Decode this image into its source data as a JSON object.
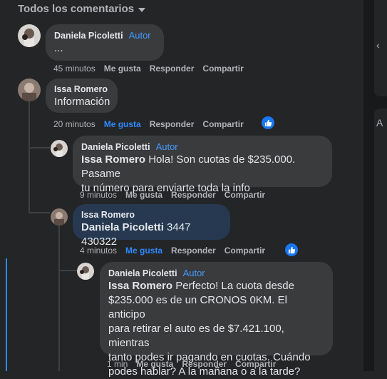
{
  "header": {
    "label": "Todos los comentarios"
  },
  "comments": [
    {
      "author": "Daniela Picoletti",
      "author_badge": "Autor",
      "text": "...",
      "time": "45 minutos",
      "like": "Me gusta",
      "reply": "Responder",
      "share": "Compartir"
    },
    {
      "author": "Issa Romero",
      "text": "Información",
      "time": "20 minutos",
      "like": "Me gusta",
      "reply": "Responder",
      "share": "Compartir",
      "liked": true
    },
    {
      "author": "Daniela Picoletti",
      "author_badge": "Autor",
      "mention": "Issa Romero",
      "text_line1": " Hola! Son cuotas de $235.000. Pasame",
      "text_line2": "tu número para enviarte toda la info",
      "time": "9 minutos",
      "like": "Me gusta",
      "reply": "Responder",
      "share": "Compartir"
    },
    {
      "author": "Issa Romero",
      "mention": "Daniela Picoletti",
      "text": " 3447 430322",
      "time": "4 minutos",
      "like": "Me gusta",
      "reply": "Responder",
      "share": "Compartir",
      "liked": true
    },
    {
      "author": "Daniela Picoletti",
      "author_badge": "Autor",
      "mention": "Issa Romero",
      "text_line1": " Perfecto! La cuota desde",
      "text_line2": "$235.000 es de un CRONOS 0KM. El anticipo",
      "text_line3": "para retirar el auto es de $7.421.100, mientras",
      "text_line4": "tanto podes ir pagando en cuotas. Cuándo",
      "text_line5": "podes hablar? A la mañana o a la tarde?",
      "time": "1 min",
      "like": "Me gusta",
      "reply": "Responder",
      "share": "Compartir"
    }
  ],
  "icons": {
    "like_badge": "thumbs-up-icon",
    "sort_caret": "caret-down-icon"
  },
  "colors": {
    "background": "#242526",
    "bubble": "#3a3b3c",
    "bubble_highlight": "#263951",
    "accent": "#2d88ff",
    "author_badge": "#4599ff"
  }
}
